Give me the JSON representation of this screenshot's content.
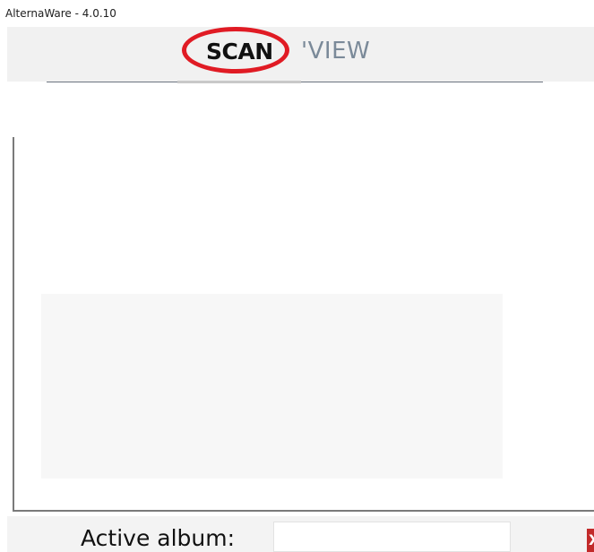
{
  "window": {
    "title": "AlternaWare - 4.0.10"
  },
  "tabs": {
    "scan_label": "SCAN",
    "view_label": "'VIEW",
    "active": "scan"
  },
  "bottom": {
    "active_album_label": "Active album:",
    "active_album_value": "",
    "close_icon_glyph": "X"
  },
  "colors": {
    "highlight_ring": "#e01b24",
    "close_button": "#c22a2a",
    "inactive_tab": "#7b8a99"
  }
}
